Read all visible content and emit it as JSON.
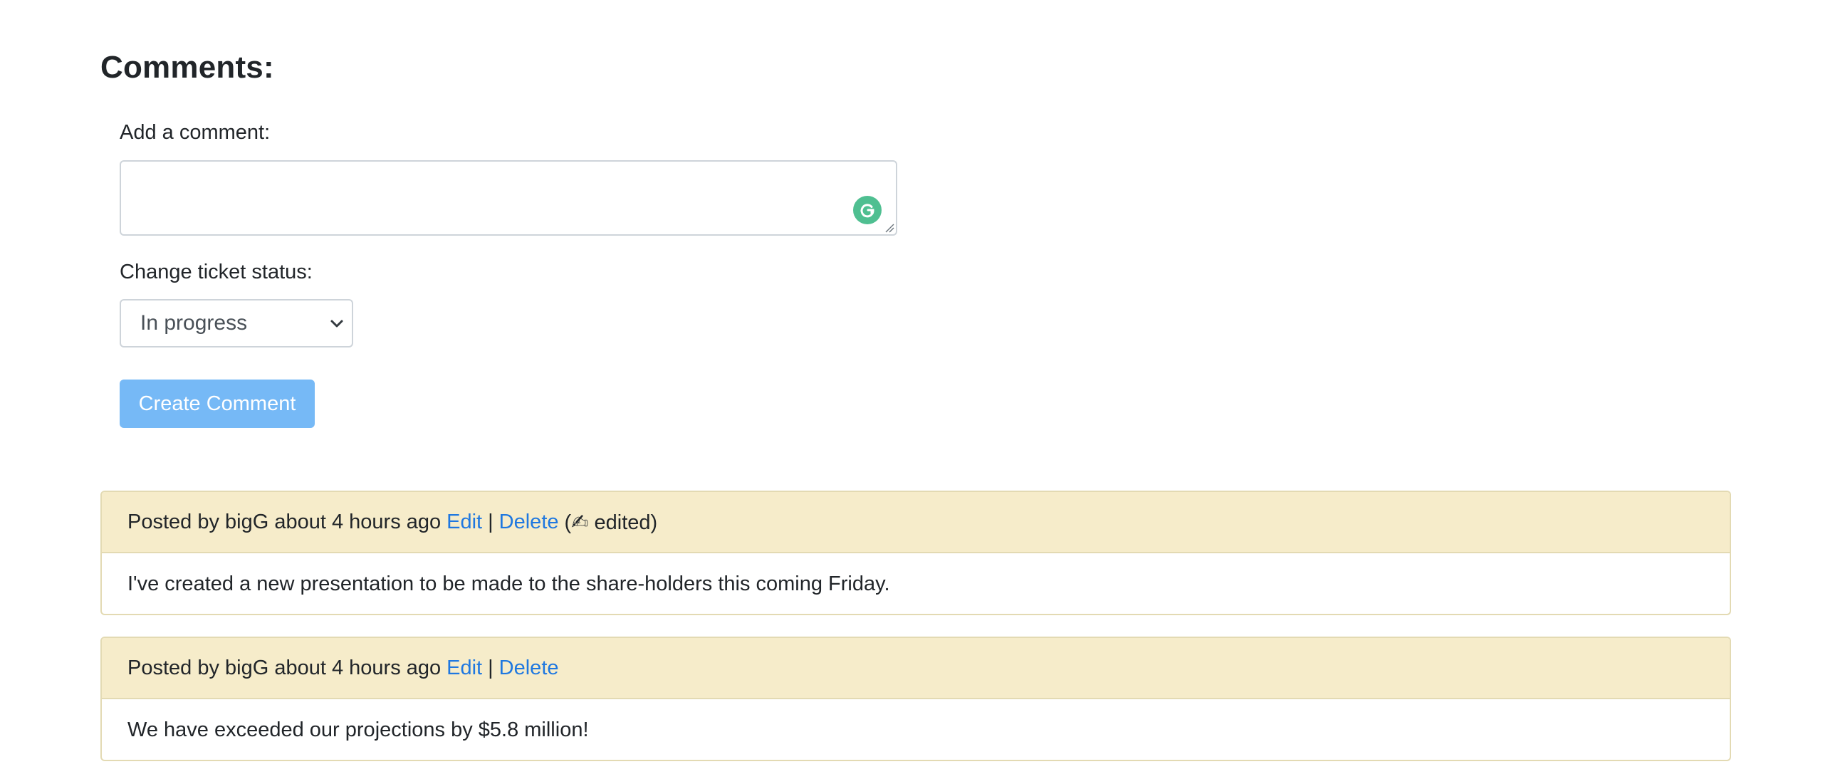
{
  "comments_section": {
    "title": "Comments:"
  },
  "form": {
    "add_comment_label": "Add a comment:",
    "comment_value": "",
    "status_label": "Change ticket status:",
    "status_selected": "In progress",
    "create_button_label": "Create Comment"
  },
  "comments": [
    {
      "posted_by_text": "Posted by bigG about 4 hours ago",
      "edit_label": "Edit",
      "separator": "|",
      "delete_label": "Delete",
      "edited_note": "(✍ edited)",
      "body": "I've created a new presentation to be made to the share-holders this coming Friday."
    },
    {
      "posted_by_text": "Posted by bigG about 4 hours ago",
      "edit_label": "Edit",
      "separator": "|",
      "delete_label": "Delete",
      "body": "We have exceeded our projections by $5.8 million!"
    }
  ],
  "colors": {
    "link": "#1f78e0",
    "button_bg": "#76b9f6",
    "card_header_bg": "#f6ecca",
    "card_border": "#e3dab3",
    "grammarly": "#4fbf91"
  },
  "icons": {
    "grammarly": "grammarly-icon",
    "select_chevron": "chevron-down-icon",
    "resize": "resize-handle-icon"
  }
}
